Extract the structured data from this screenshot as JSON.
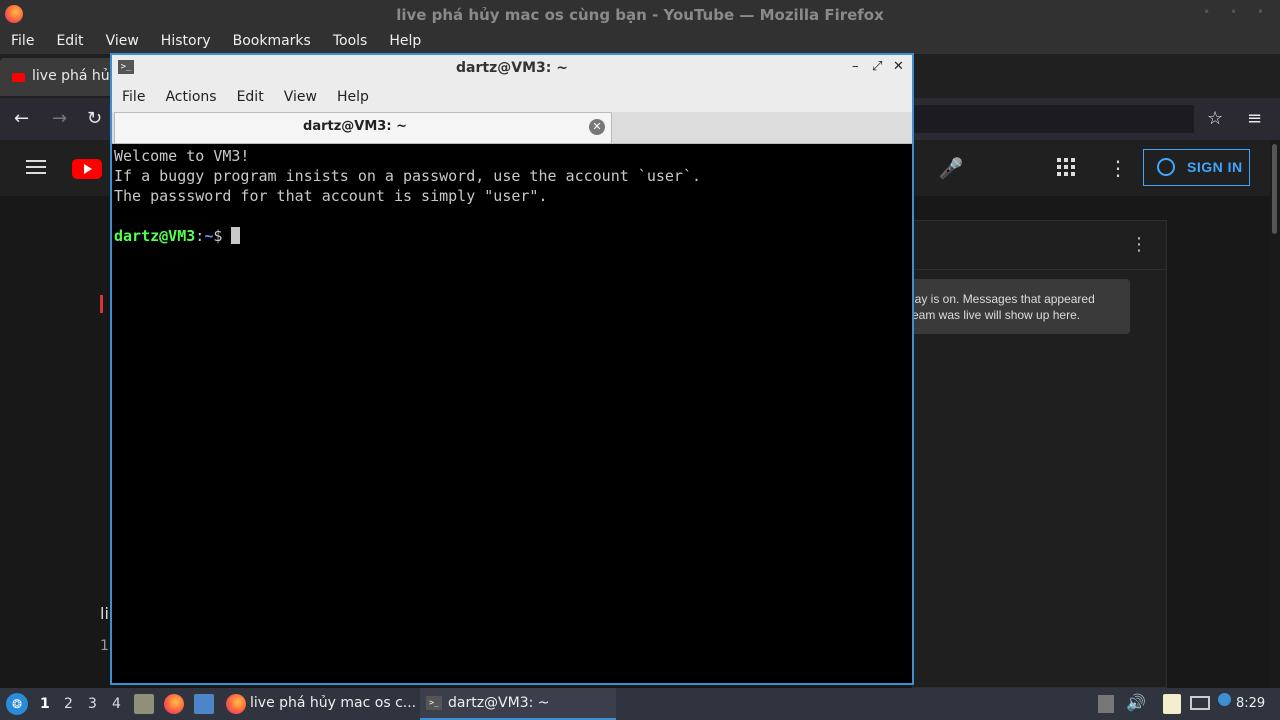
{
  "firefox": {
    "window_title": "live phá hủy mac os cùng bạn - YouTube — Mozilla Firefox",
    "menu": [
      "File",
      "Edit",
      "View",
      "History",
      "Bookmarks",
      "Tools",
      "Help"
    ],
    "tab_label": "live phá hủy",
    "window_buttons": "• • •"
  },
  "youtube": {
    "sign_in_label": "SIGN IN",
    "chat_notice": "lay is on. Messages that appeared\neam was live will show up here.",
    "mic_icon": "🎤",
    "apps_icon": "⋮⋮⋮",
    "more_icon": "⋮",
    "chat_more_icon": "⋮",
    "left_fragments": [
      "li",
      "1"
    ]
  },
  "terminal": {
    "title": "dartz@VM3: ~",
    "menu": [
      "File",
      "Actions",
      "Edit",
      "View",
      "Help"
    ],
    "tab_title": "dartz@VM3: ~",
    "tab_close": "✕",
    "minimize": "–",
    "maximize": "⤢",
    "close": "✕",
    "lines": [
      "Welcome to VM3!",
      "If a buggy program insists on a password, use the account `user`.",
      "The passsword for that account is simply \"user\"."
    ],
    "prompt_user": "dartz@VM3",
    "prompt_sep": ":",
    "prompt_path": "~",
    "prompt_symbol": "$ "
  },
  "taskbar": {
    "workspaces": [
      "1",
      "2",
      "3",
      "4"
    ],
    "active_workspace": "1",
    "tasks": [
      {
        "label": "live phá hủy mac os c..."
      },
      {
        "label": "dartz@VM3: ~"
      }
    ],
    "clock": "8:29"
  },
  "colors": {
    "accent": "#3d8fd1",
    "youtube_red": "#ff0000",
    "prompt_user": "#54ff54",
    "prompt_path": "#5599ff",
    "sign_in_blue": "#3ea6ff"
  }
}
